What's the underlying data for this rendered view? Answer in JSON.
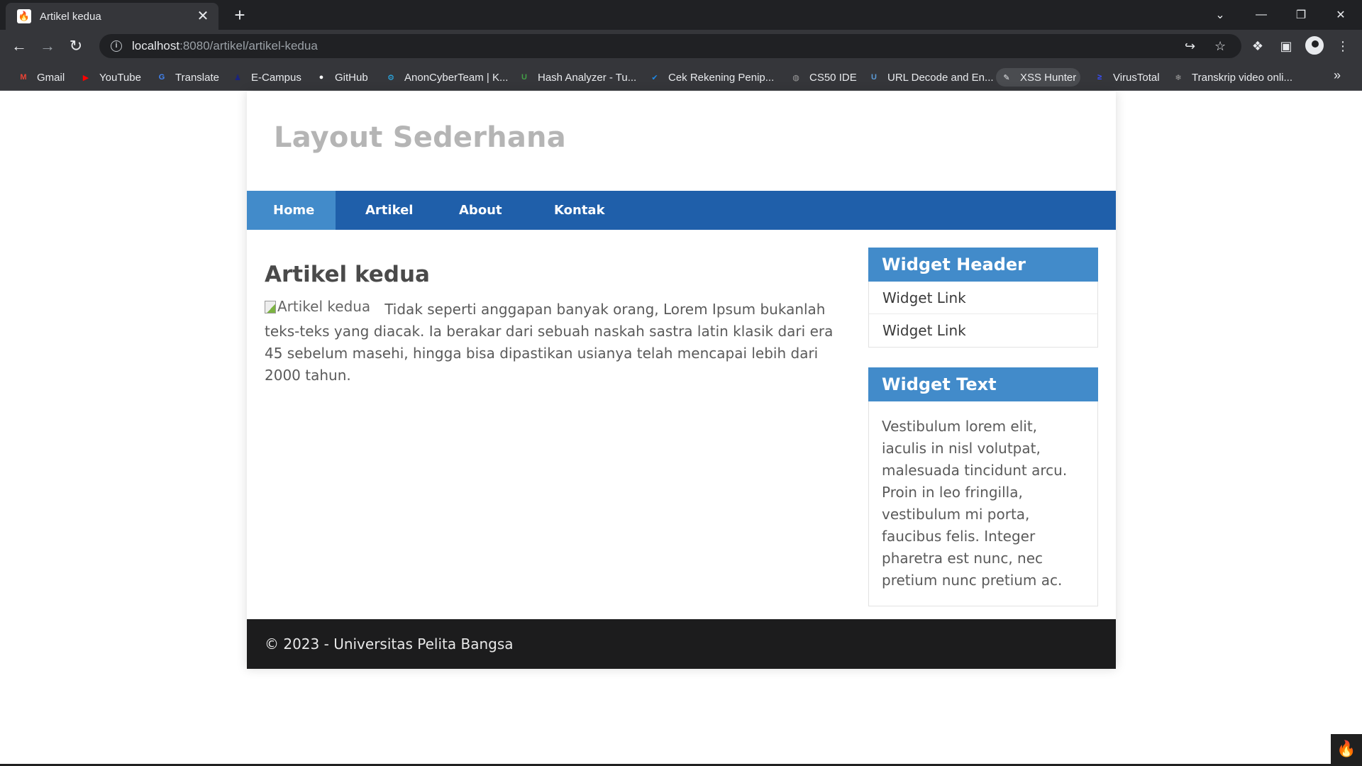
{
  "browser": {
    "tab": {
      "title": "Artikel kedua",
      "favicon": "codeigniter-flame-icon",
      "close": "✕"
    },
    "new_tab": "+",
    "url_host": "localhost",
    "url_rest": ":8080/artikel/artikel-kedua",
    "bookmarks": [
      {
        "label": "Gmail",
        "icon": "gmail-icon",
        "color": "#ea4335"
      },
      {
        "label": "YouTube",
        "icon": "youtube-icon",
        "color": "#ff0000"
      },
      {
        "label": "Translate",
        "icon": "translate-icon",
        "color": "#4285f4"
      },
      {
        "label": "E-Campus",
        "icon": "ecampus-icon",
        "color": "#1a237e"
      },
      {
        "label": "GitHub",
        "icon": "github-icon",
        "color": "#ffffff"
      },
      {
        "label": "AnonCyberTeam | K...",
        "icon": "anoncyberteam-icon",
        "color": "#29b6f6"
      },
      {
        "label": "Hash Analyzer - Tu...",
        "icon": "hash-analyzer-icon",
        "color": "#43a047"
      },
      {
        "label": "Cek Rekening Penip...",
        "icon": "cek-rekening-icon",
        "color": "#1e88e5"
      },
      {
        "label": "CS50 IDE",
        "icon": "cs50-icon",
        "color": "#9e9e9e"
      },
      {
        "label": "URL Decode and En...",
        "icon": "url-decode-icon",
        "color": "#5c9bd6"
      },
      {
        "label": "XSS Hunter",
        "icon": "xss-hunter-icon",
        "color": "#e8eaed"
      },
      {
        "label": "VirusTotal",
        "icon": "virustotal-icon",
        "color": "#394eff"
      },
      {
        "label": "Transkrip video onli...",
        "icon": "transkrip-icon",
        "color": "#9e9e9e"
      }
    ]
  },
  "page": {
    "site_title": "Layout Sederhana",
    "nav": [
      {
        "label": "Home",
        "active": true
      },
      {
        "label": "Artikel",
        "active": false
      },
      {
        "label": "About",
        "active": false
      },
      {
        "label": "Kontak",
        "active": false
      }
    ],
    "article": {
      "title": "Artikel kedua",
      "image_alt": "Artikel kedua",
      "body": "Tidak seperti anggapan banyak orang, Lorem Ipsum bukanlah teks-teks yang diacak. Ia berakar dari sebuah naskah sastra latin klasik dari era 45 sebelum masehi, hingga bisa dipastikan usianya telah mencapai lebih dari 2000 tahun."
    },
    "sidebar": {
      "widget1_header": "Widget Header",
      "widget1_links": [
        "Widget Link",
        "Widget Link"
      ],
      "widget2_header": "Widget Text",
      "widget2_text": "Vestibulum lorem elit, iaculis in nisl volutpat, malesuada tincidunt arcu. Proin in leo fringilla, vestibulum mi porta, faucibus felis. Integer pharetra est nunc, nec pretium nunc pretium ac."
    },
    "footer": "© 2023 - Universitas Pelita Bangsa",
    "colors": {
      "nav_bg": "#1f5faa",
      "nav_active": "#428bca",
      "widget_header": "#428bca",
      "footer_bg": "#1c1c1d"
    }
  }
}
